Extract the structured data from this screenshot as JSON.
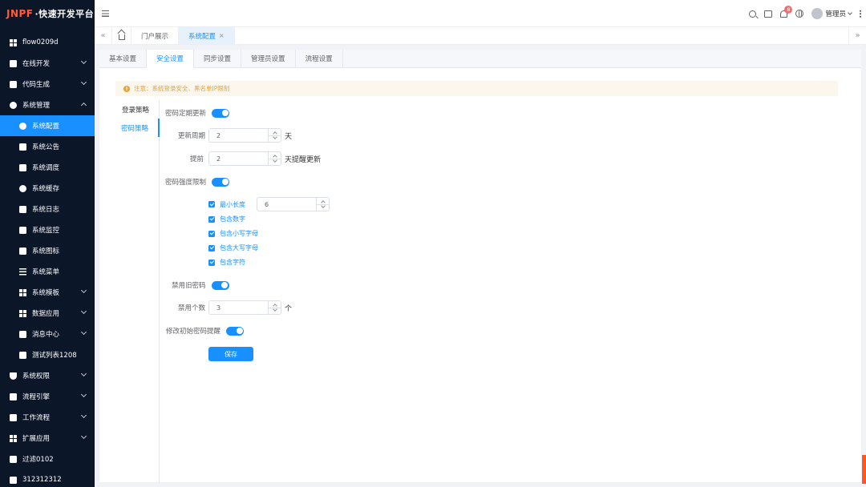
{
  "app": {
    "logo_mark": "JNPF",
    "logo_text": "·快速开发平台"
  },
  "sidebar": {
    "items": [
      {
        "label": "flow0209d"
      },
      {
        "label": "在线开发"
      },
      {
        "label": "代码生成"
      },
      {
        "label": "系统管理"
      },
      {
        "label": "系统配置"
      },
      {
        "label": "系统公告"
      },
      {
        "label": "系统调度"
      },
      {
        "label": "系统缓存"
      },
      {
        "label": "系统日志"
      },
      {
        "label": "系统监控"
      },
      {
        "label": "系统图标"
      },
      {
        "label": "系统菜单"
      },
      {
        "label": "系统模板"
      },
      {
        "label": "数据应用"
      },
      {
        "label": "消息中心"
      },
      {
        "label": "测试列表1208"
      },
      {
        "label": "系统权限"
      },
      {
        "label": "流程引擎"
      },
      {
        "label": "工作流程"
      },
      {
        "label": "扩展应用"
      },
      {
        "label": "过滤0102"
      },
      {
        "label": "312312312"
      }
    ]
  },
  "header": {
    "notification_count": "8",
    "user_name": "管理员"
  },
  "tabs": {
    "items": [
      {
        "label": "门户展示"
      },
      {
        "label": "系统配置"
      }
    ],
    "close": "×"
  },
  "subtabs": {
    "items": [
      {
        "label": "基本设置"
      },
      {
        "label": "安全设置"
      },
      {
        "label": "同步设置"
      },
      {
        "label": "管理员设置"
      },
      {
        "label": "流程设置"
      }
    ]
  },
  "notice": {
    "text": "注意：系统登录安全、黑名单IP限制",
    "icon": "!"
  },
  "leftnav": {
    "items": [
      {
        "label": "登录策略"
      },
      {
        "label": "密码策略"
      }
    ]
  },
  "form": {
    "password_expire_label": "密码定期更新",
    "update_cycle_label": "更新周期",
    "update_cycle_value": "2",
    "update_cycle_unit": "天",
    "advance_label": "提前",
    "advance_value": "2",
    "advance_unit": "天提醒更新",
    "strength_label": "密码强度限制",
    "min_length_label": "最小长度",
    "min_length_value": "6",
    "contains_digits": "包含数字",
    "contains_lowercase": "包含小写字母",
    "contains_uppercase": "包含大写字母",
    "contains_symbols": "包含字符",
    "disable_old_label": "禁用旧密码",
    "disable_count_label": "禁用个数",
    "disable_count_value": "3",
    "disable_count_unit": "个",
    "initial_remind_label": "修改初始密码提醒",
    "save_label": "保存"
  },
  "colors": {
    "accent": "#1890ff",
    "sidebar_bg": "#0c1629",
    "warning": "#e6a23c",
    "logo": "#ff5b3a"
  }
}
